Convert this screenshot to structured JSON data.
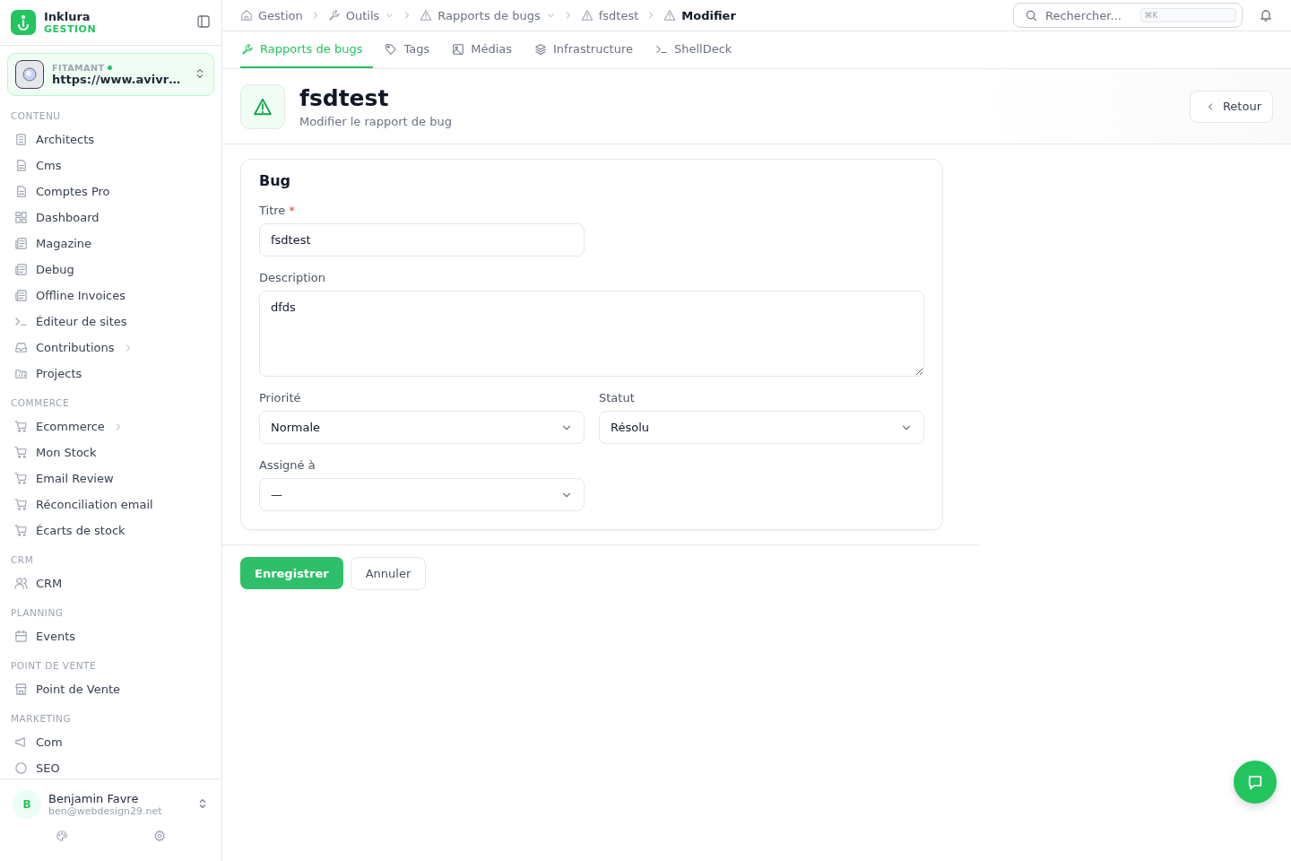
{
  "brand": {
    "name": "Inklura",
    "subtitle": "GESTION"
  },
  "workspace": {
    "label": "FITAMANT",
    "online": true,
    "url": "https://www.avivr…"
  },
  "sidebar": {
    "sections": [
      {
        "title": "CONTENU",
        "items": [
          {
            "label": "Architects",
            "kind": "building",
            "submenu": false
          },
          {
            "label": "Cms",
            "kind": "document",
            "submenu": false
          },
          {
            "label": "Comptes Pro",
            "kind": "document",
            "submenu": false
          },
          {
            "label": "Dashboard",
            "kind": "grid",
            "submenu": false
          },
          {
            "label": "Magazine",
            "kind": "newspaper",
            "submenu": false
          },
          {
            "label": "Debug",
            "kind": "newspaper",
            "submenu": false
          },
          {
            "label": "Offline Invoices",
            "kind": "newspaper",
            "submenu": false
          },
          {
            "label": "Éditeur de sites",
            "kind": "terminal",
            "submenu": false
          },
          {
            "label": "Contributions",
            "kind": "inbox",
            "submenu": true
          },
          {
            "label": "Projects",
            "kind": "folder",
            "submenu": false
          }
        ]
      },
      {
        "title": "COMMERCE",
        "items": [
          {
            "label": "Ecommerce",
            "kind": "cart",
            "submenu": true
          },
          {
            "label": "Mon Stock",
            "kind": "cart",
            "submenu": false
          },
          {
            "label": "Email Review",
            "kind": "cart",
            "submenu": false
          },
          {
            "label": "Réconciliation email",
            "kind": "cart",
            "submenu": false
          },
          {
            "label": "Écarts de stock",
            "kind": "cart",
            "submenu": false
          }
        ]
      },
      {
        "title": "CRM",
        "items": [
          {
            "label": "CRM",
            "kind": "users",
            "submenu": false
          }
        ]
      },
      {
        "title": "PLANNING",
        "items": [
          {
            "label": "Events",
            "kind": "calendar",
            "submenu": false
          }
        ]
      },
      {
        "title": "POINT DE VENTE",
        "items": [
          {
            "label": "Point de Vente",
            "kind": "store",
            "submenu": false
          }
        ]
      },
      {
        "title": "MARKETING",
        "items": [
          {
            "label": "Com",
            "kind": "megaphone",
            "submenu": false
          },
          {
            "label": "SEO",
            "kind": "circle",
            "submenu": false
          }
        ]
      }
    ]
  },
  "user": {
    "initial": "B",
    "name": "Benjamin Favre",
    "email": "ben@webdesign29.net"
  },
  "breadcrumb": [
    {
      "label": "Gestion",
      "kind": "home",
      "dropdown": false,
      "current": false
    },
    {
      "label": "Outils",
      "kind": "wrench",
      "dropdown": true,
      "current": false
    },
    {
      "label": "Rapports de bugs",
      "kind": "alert",
      "dropdown": true,
      "current": false
    },
    {
      "label": "fsdtest",
      "kind": "alert",
      "dropdown": false,
      "current": false
    },
    {
      "label": "Modifier",
      "kind": "alert",
      "dropdown": false,
      "current": true
    }
  ],
  "search": {
    "placeholder": "Rechercher...",
    "shortcut": "⌘K"
  },
  "tabs": [
    {
      "label": "Rapports de bugs",
      "kind": "wrench",
      "selected": true
    },
    {
      "label": "Tags",
      "kind": "tag",
      "selected": false
    },
    {
      "label": "Médias",
      "kind": "image",
      "selected": false
    },
    {
      "label": "Infrastructure",
      "kind": "layers",
      "selected": false
    },
    {
      "label": "ShellDeck",
      "kind": "terminal",
      "selected": false
    }
  ],
  "page": {
    "title": "fsdtest",
    "subtitle": "Modifier le rapport de bug",
    "back": "Retour"
  },
  "form": {
    "title": "Bug",
    "rows": [
      [
        {
          "label": "Titre",
          "kind": "text",
          "required_mark": "*",
          "value": "fsdtest"
        }
      ],
      [
        {
          "label": "Description",
          "kind": "textarea",
          "value": "dfds"
        }
      ],
      [
        {
          "label": "Priorité",
          "kind": "select",
          "value": "Normale"
        },
        {
          "label": "Statut",
          "kind": "select",
          "value": "Résolu"
        }
      ],
      [
        {
          "label": "Assigné à",
          "kind": "select",
          "value": "—"
        }
      ]
    ]
  },
  "actions": {
    "save": "Enregistrer",
    "cancel": "Annuler"
  }
}
